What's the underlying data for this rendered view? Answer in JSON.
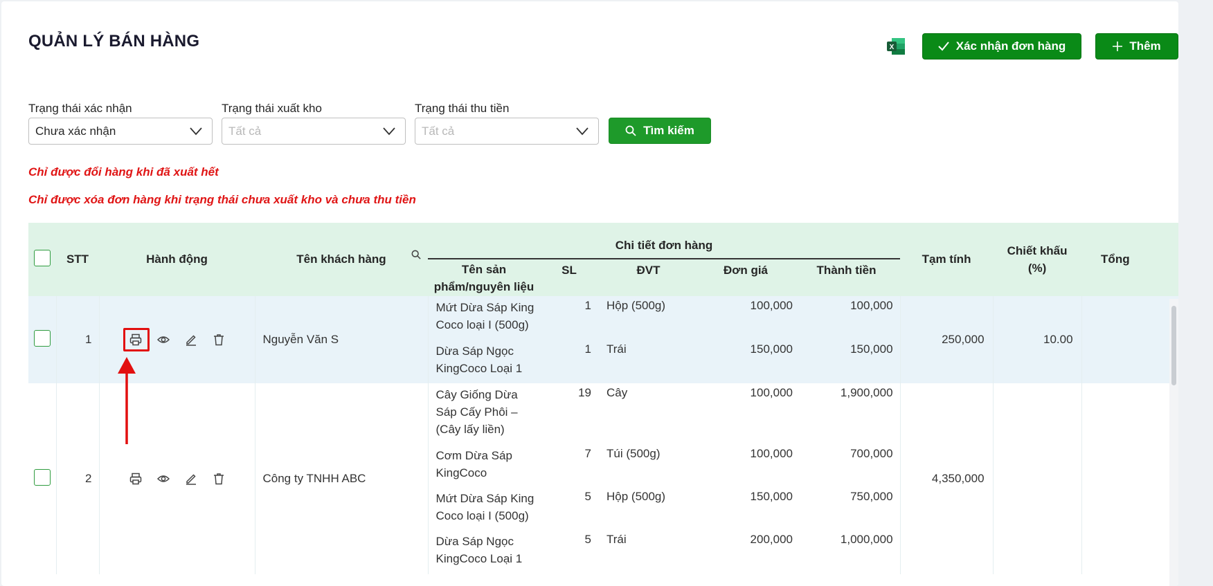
{
  "page": {
    "title": "QUẢN LÝ BÁN HÀNG",
    "excel_icon": "excel-icon",
    "confirm_button": "Xác nhận đơn hàng",
    "add_button": "Thêm"
  },
  "filters": {
    "confirm_status": {
      "label": "Trạng thái xác nhận",
      "value": "Chưa xác nhận"
    },
    "export_status": {
      "label": "Trạng thái xuất kho",
      "placeholder": "Tất cả"
    },
    "payment_status": {
      "label": "Trạng thái thu tiền",
      "placeholder": "Tất cả"
    },
    "search_button": "Tìm kiếm"
  },
  "warnings": {
    "exchange": "Chỉ được đổi hàng khi đã xuất hết",
    "delete": "Chỉ được xóa đơn hàng khi trạng thái chưa xuất kho và chưa thu tiền"
  },
  "table": {
    "headers": {
      "stt": "STT",
      "actions": "Hành động",
      "customer": "Tên khách hàng",
      "order_detail": "Chi tiết đơn hàng",
      "product": "Tên sản phẩm/nguyên liệu",
      "qty": "SL",
      "unit": "ĐVT",
      "unit_price": "Đơn giá",
      "amount": "Thành tiền",
      "subtotal": "Tạm tính",
      "discount": "Chiết khấu (%)",
      "total": "Tổng"
    },
    "rows": [
      {
        "stt": "1",
        "customer": "Nguyễn Văn S",
        "subtotal": "250,000",
        "discount": "10.00",
        "items": [
          {
            "product": "Mứt Dừa Sáp King Coco loại I (500g)",
            "qty": "1",
            "unit": "Hộp (500g)",
            "price": "100,000",
            "amount": "100,000"
          },
          {
            "product": "Dừa Sáp Ngọc KingCoco Loại 1",
            "qty": "1",
            "unit": "Trái",
            "price": "150,000",
            "amount": "150,000"
          }
        ]
      },
      {
        "stt": "2",
        "customer": "Công ty TNHH ABC",
        "subtotal": "4,350,000",
        "discount": "",
        "items": [
          {
            "product": "Cây Giống Dừa Sáp Cấy Phôi – (Cây lấy liền)",
            "qty": "19",
            "unit": "Cây",
            "price": "100,000",
            "amount": "1,900,000"
          },
          {
            "product": "Cơm Dừa Sáp KingCoco",
            "qty": "7",
            "unit": "Túi (500g)",
            "price": "100,000",
            "amount": "700,000"
          },
          {
            "product": "Mứt Dừa Sáp King Coco loại I (500g)",
            "qty": "5",
            "unit": "Hộp (500g)",
            "price": "150,000",
            "amount": "750,000"
          },
          {
            "product": "Dừa Sáp Ngọc KingCoco Loại 1",
            "qty": "5",
            "unit": "Trái",
            "price": "200,000",
            "amount": "1,000,000"
          }
        ]
      }
    ]
  },
  "colors": {
    "primary_green": "#0a8a17",
    "warning_red": "#e01515",
    "header_bg": "#dff3e7",
    "highlight_red": "#e20f0f"
  }
}
